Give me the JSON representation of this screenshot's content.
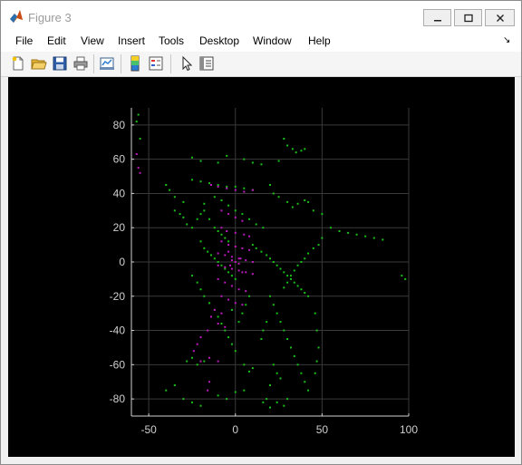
{
  "window": {
    "title": "Figure 3"
  },
  "menu": [
    "File",
    "Edit",
    "View",
    "Insert",
    "Tools",
    "Desktop",
    "Window",
    "Help"
  ],
  "toolbar_icons": [
    "new-figure-icon",
    "open-file-icon",
    "save-icon",
    "print-icon",
    "link-plot-icon",
    "colorbar-icon",
    "legend-icon",
    "pointer-icon",
    "property-inspector-icon"
  ],
  "colors": {
    "points_green": "#18c018",
    "points_magenta": "#c019c0",
    "axes_bg": "#000000",
    "tick_text": "#cfcfcf"
  },
  "chart_data": {
    "type": "scatter",
    "title": "",
    "xlabel": "",
    "ylabel": "",
    "xlim": [
      -60,
      100
    ],
    "ylim": [
      -90,
      90
    ],
    "xticks": [
      -50,
      0,
      50,
      100
    ],
    "yticks": [
      -80,
      -60,
      -40,
      -20,
      0,
      20,
      40,
      60,
      80
    ],
    "xticklabels": [
      "-50",
      "0",
      "50",
      "100"
    ],
    "yticklabels": [
      "-80",
      "-60",
      "-40",
      "-20",
      "0",
      "20",
      "40",
      "60",
      "80"
    ],
    "grid": true,
    "series": [
      {
        "color": "#18c018",
        "points": [
          [
            -56,
            86
          ],
          [
            -57,
            82
          ],
          [
            -55,
            72
          ],
          [
            -25,
            61
          ],
          [
            -20,
            59
          ],
          [
            -10,
            58
          ],
          [
            -5,
            62
          ],
          [
            5,
            60
          ],
          [
            10,
            58
          ],
          [
            15,
            57
          ],
          [
            25,
            59
          ],
          [
            28,
            72
          ],
          [
            30,
            68
          ],
          [
            33,
            66
          ],
          [
            35,
            64
          ],
          [
            38,
            65
          ],
          [
            40,
            66
          ],
          [
            -40,
            45
          ],
          [
            -38,
            42
          ],
          [
            -35,
            38
          ],
          [
            -30,
            35
          ],
          [
            -25,
            48
          ],
          [
            -20,
            47
          ],
          [
            -15,
            46
          ],
          [
            -10,
            45
          ],
          [
            -5,
            44
          ],
          [
            0,
            44
          ],
          [
            5,
            43
          ],
          [
            10,
            42
          ],
          [
            20,
            45
          ],
          [
            22,
            40
          ],
          [
            25,
            38
          ],
          [
            30,
            35
          ],
          [
            33,
            32
          ],
          [
            36,
            34
          ],
          [
            40,
            36
          ],
          [
            42,
            35
          ],
          [
            45,
            30
          ],
          [
            50,
            28
          ],
          [
            -35,
            30
          ],
          [
            -32,
            28
          ],
          [
            -30,
            26
          ],
          [
            -28,
            22
          ],
          [
            -25,
            20
          ],
          [
            -22,
            25
          ],
          [
            -20,
            28
          ],
          [
            -18,
            30
          ],
          [
            -15,
            25
          ],
          [
            -12,
            20
          ],
          [
            -10,
            18
          ],
          [
            -8,
            16
          ],
          [
            -6,
            14
          ],
          [
            -4,
            12
          ],
          [
            -20,
            12
          ],
          [
            -18,
            8
          ],
          [
            -16,
            6
          ],
          [
            -14,
            4
          ],
          [
            -12,
            2
          ],
          [
            -10,
            0
          ],
          [
            -8,
            -2
          ],
          [
            -6,
            -4
          ],
          [
            -4,
            -6
          ],
          [
            -2,
            -8
          ],
          [
            0,
            -10
          ],
          [
            10,
            10
          ],
          [
            12,
            8
          ],
          [
            15,
            6
          ],
          [
            18,
            4
          ],
          [
            20,
            2
          ],
          [
            22,
            0
          ],
          [
            24,
            -2
          ],
          [
            26,
            -4
          ],
          [
            28,
            -6
          ],
          [
            30,
            -8
          ],
          [
            32,
            -10
          ],
          [
            34,
            -12
          ],
          [
            36,
            -14
          ],
          [
            38,
            -16
          ],
          [
            40,
            -18
          ],
          [
            42,
            -20
          ],
          [
            55,
            20
          ],
          [
            60,
            18
          ],
          [
            65,
            17
          ],
          [
            70,
            16
          ],
          [
            75,
            15
          ],
          [
            80,
            14
          ],
          [
            85,
            13
          ],
          [
            50,
            14
          ],
          [
            48,
            10
          ],
          [
            45,
            8
          ],
          [
            42,
            5
          ],
          [
            40,
            2
          ],
          [
            38,
            0
          ],
          [
            36,
            -2
          ],
          [
            34,
            -5
          ],
          [
            32,
            -8
          ],
          [
            30,
            -12
          ],
          [
            28,
            -15
          ],
          [
            -25,
            -8
          ],
          [
            -22,
            -12
          ],
          [
            -20,
            -16
          ],
          [
            -18,
            -20
          ],
          [
            -15,
            -24
          ],
          [
            -12,
            -28
          ],
          [
            -10,
            -32
          ],
          [
            -8,
            -36
          ],
          [
            -6,
            -40
          ],
          [
            -4,
            -44
          ],
          [
            -2,
            -48
          ],
          [
            0,
            -52
          ],
          [
            20,
            -20
          ],
          [
            22,
            -25
          ],
          [
            24,
            -30
          ],
          [
            26,
            -35
          ],
          [
            28,
            -40
          ],
          [
            30,
            -45
          ],
          [
            32,
            -50
          ],
          [
            34,
            -55
          ],
          [
            36,
            -60
          ],
          [
            38,
            -65
          ],
          [
            40,
            -70
          ],
          [
            42,
            -75
          ],
          [
            22,
            -60
          ],
          [
            24,
            -65
          ],
          [
            26,
            -68
          ],
          [
            20,
            -72
          ],
          [
            18,
            -80
          ],
          [
            16,
            -82
          ],
          [
            20,
            -85
          ],
          [
            24,
            -82
          ],
          [
            28,
            -84
          ],
          [
            30,
            -80
          ],
          [
            -30,
            -80
          ],
          [
            -25,
            -82
          ],
          [
            -20,
            -84
          ],
          [
            -10,
            -78
          ],
          [
            -5,
            -80
          ],
          [
            0,
            -76
          ],
          [
            5,
            -75
          ],
          [
            -40,
            -75
          ],
          [
            -35,
            -72
          ],
          [
            -28,
            -58
          ],
          [
            -25,
            -56
          ],
          [
            -22,
            -60
          ],
          [
            -18,
            -58
          ],
          [
            5,
            -60
          ],
          [
            8,
            -64
          ],
          [
            10,
            -62
          ],
          [
            15,
            -45
          ],
          [
            16,
            -40
          ],
          [
            18,
            -35
          ],
          [
            98,
            -10
          ],
          [
            96,
            -8
          ],
          [
            -18,
            34
          ],
          [
            -12,
            38
          ],
          [
            -8,
            36
          ],
          [
            -4,
            33
          ],
          [
            0,
            30
          ],
          [
            4,
            28
          ],
          [
            8,
            25
          ],
          [
            12,
            22
          ],
          [
            16,
            20
          ],
          [
            8,
            -20
          ],
          [
            6,
            -25
          ],
          [
            4,
            -30
          ],
          [
            2,
            -35
          ],
          [
            -2,
            -28
          ],
          [
            46,
            -30
          ],
          [
            47,
            -40
          ],
          [
            48,
            -50
          ],
          [
            47,
            -58
          ],
          [
            46,
            -65
          ]
        ]
      },
      {
        "color": "#c019c0",
        "points": [
          [
            -57,
            63
          ],
          [
            -56,
            55
          ],
          [
            -55,
            52
          ],
          [
            -14,
            45
          ],
          [
            -10,
            44
          ],
          [
            -5,
            43
          ],
          [
            0,
            42
          ],
          [
            5,
            41
          ],
          [
            10,
            42
          ],
          [
            -8,
            30
          ],
          [
            -4,
            28
          ],
          [
            0,
            26
          ],
          [
            4,
            24
          ],
          [
            -8,
            20
          ],
          [
            -5,
            18
          ],
          [
            0,
            17
          ],
          [
            5,
            16
          ],
          [
            8,
            15
          ],
          [
            -8,
            12
          ],
          [
            -4,
            10
          ],
          [
            0,
            9
          ],
          [
            4,
            8
          ],
          [
            8,
            7
          ],
          [
            -10,
            5
          ],
          [
            -6,
            4
          ],
          [
            -2,
            3
          ],
          [
            2,
            2
          ],
          [
            6,
            1
          ],
          [
            10,
            0
          ],
          [
            -10,
            -2
          ],
          [
            -6,
            -3
          ],
          [
            -2,
            -4
          ],
          [
            2,
            -5
          ],
          [
            6,
            -6
          ],
          [
            10,
            -7
          ],
          [
            -10,
            -10
          ],
          [
            -6,
            -12
          ],
          [
            -2,
            -14
          ],
          [
            2,
            -16
          ],
          [
            6,
            -17
          ],
          [
            -8,
            -20
          ],
          [
            -4,
            -22
          ],
          [
            0,
            -24
          ],
          [
            4,
            -25
          ],
          [
            -12,
            -28
          ],
          [
            -8,
            -30
          ],
          [
            -14,
            -32
          ],
          [
            -10,
            -36
          ],
          [
            -6,
            -38
          ],
          [
            -16,
            -40
          ],
          [
            -20,
            -44
          ],
          [
            -22,
            -48
          ],
          [
            -24,
            -52
          ],
          [
            -20,
            -58
          ],
          [
            -15,
            -56
          ],
          [
            -10,
            -58
          ],
          [
            0,
            0
          ],
          [
            -2,
            1
          ],
          [
            2,
            -1
          ],
          [
            -3,
            -2
          ],
          [
            3,
            2
          ],
          [
            -4,
            6
          ],
          [
            4,
            -6
          ],
          [
            -15,
            -70
          ],
          [
            -16,
            -75
          ]
        ]
      }
    ]
  }
}
